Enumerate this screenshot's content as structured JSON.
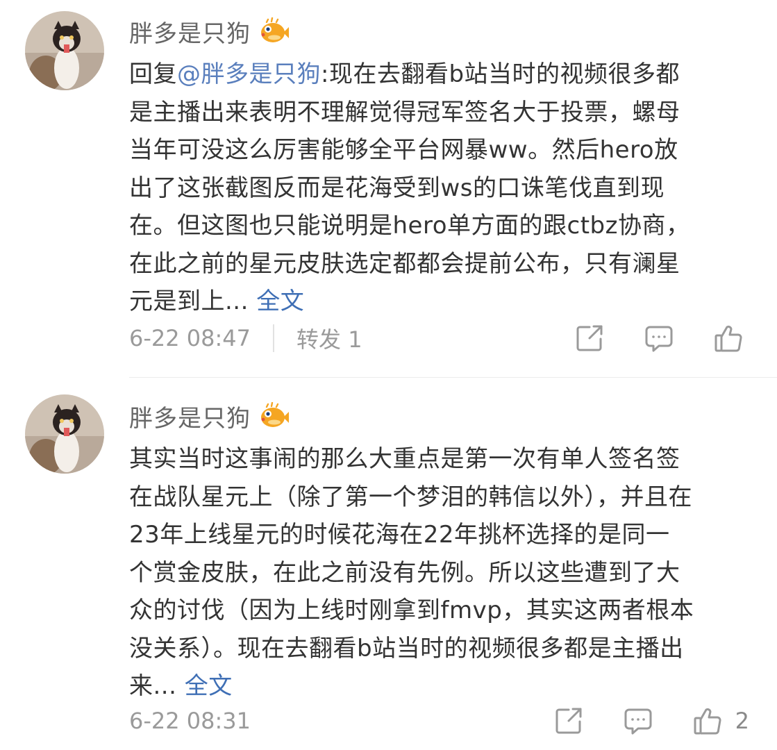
{
  "comments": [
    {
      "username": "胖多是只狗",
      "badge_icon": "pufferfish-icon",
      "reply_prefix": "回复",
      "mention": "@胖多是只狗",
      "lines": [
        ":现在去翻看b站当时的视频很多都",
        "是主播出来表明不理解觉得冠军签名大于投票，螺母",
        "当年可没这么厉害能够全平台网暴ww。然后hero放",
        "出了这张截图反而是花海受到ws的口诛笔伐直到现",
        "在。但这图也只能说明是hero单方面的跟ctbz协商，",
        "在此之前的星元皮肤选定都都会提前公布，只有澜星",
        "元是到上... "
      ],
      "fulltext_label": "全文",
      "time": "6-22 08:47",
      "repost_label": "转发 1",
      "like_count": ""
    },
    {
      "username": "胖多是只狗",
      "badge_icon": "pufferfish-icon",
      "lines": [
        "其实当时这事闹的那么大重点是第一次有单人签名签",
        "在战队星元上（除了第一个梦泪的韩信以外），并且在",
        "23年上线星元的时候花海在22年挑杯选择的是同一",
        "个赏金皮肤，在此之前没有先例。所以这些遭到了大",
        "众的讨伐（因为上线时刚拿到fmvp，其实这两者根本",
        "没关系）。现在去翻看b站当时的视频很多都是主播出",
        "来... "
      ],
      "fulltext_label": "全文",
      "time": "6-22 08:31",
      "like_count": "2"
    }
  ],
  "icons": {
    "share": "share-icon",
    "comment": "comment-icon",
    "like": "thumbs-up-icon"
  },
  "colors": {
    "link": "#3f6fb5",
    "meta": "#9a9a9a",
    "badge": "#f5a623"
  }
}
